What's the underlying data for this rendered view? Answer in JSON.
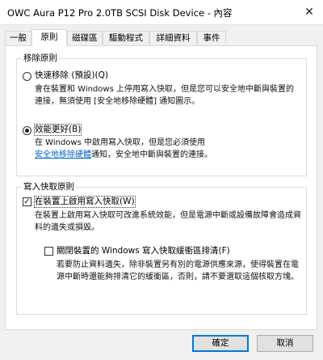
{
  "window": {
    "title": "OWC Aura  P12 Pro 2.0TB SCSI Disk Device - 內容",
    "close_glyph": "✕"
  },
  "tabs": [
    {
      "label": "一般"
    },
    {
      "label": "原則"
    },
    {
      "label": "磁碟區"
    },
    {
      "label": "驅動程式"
    },
    {
      "label": "詳細資料"
    },
    {
      "label": "事件"
    }
  ],
  "removal_policy": {
    "title": "移除原則",
    "quick_removal": {
      "label": "快速移除 (預設)(Q)",
      "description": "會在裝置和 Windows 上停用寫入快取，但是您可以安全地中斷與裝置的連接，無須使用 [安全地移除硬體] 通知圖示。",
      "selected": false
    },
    "better_performance": {
      "label": "效能更好(B)",
      "description_before": "在 Windows 中啟用寫入快取，但是您必須使用",
      "link": "安全地移除硬體",
      "description_after": "通知，安全地中斷與裝置的連接。",
      "selected": true
    }
  },
  "write_cache_policy": {
    "title": "寫入快取原則",
    "enable_write_cache": {
      "label": "在裝置上啟用寫入快取(W)",
      "description": "在裝置上啟用寫入快取可改進系統效能，但是電源中斷或設備故障會造成資料的遺失或損毀。",
      "checked": true
    },
    "disable_buffer_flush": {
      "label": "關閉裝置的 Windows 寫入快取緩衝區排清(F)",
      "description": "若要防止資料遺失，除非裝置另有別的電源供應來源，使得裝置在電源中斷時還能夠排清它的緩衝區，否則，請不要選取這個核取方塊。",
      "checked": false
    }
  },
  "buttons": {
    "ok": "確定",
    "cancel": "取消"
  },
  "colors": {
    "link": "#0066cc",
    "default_button_border": "#0078d7"
  }
}
